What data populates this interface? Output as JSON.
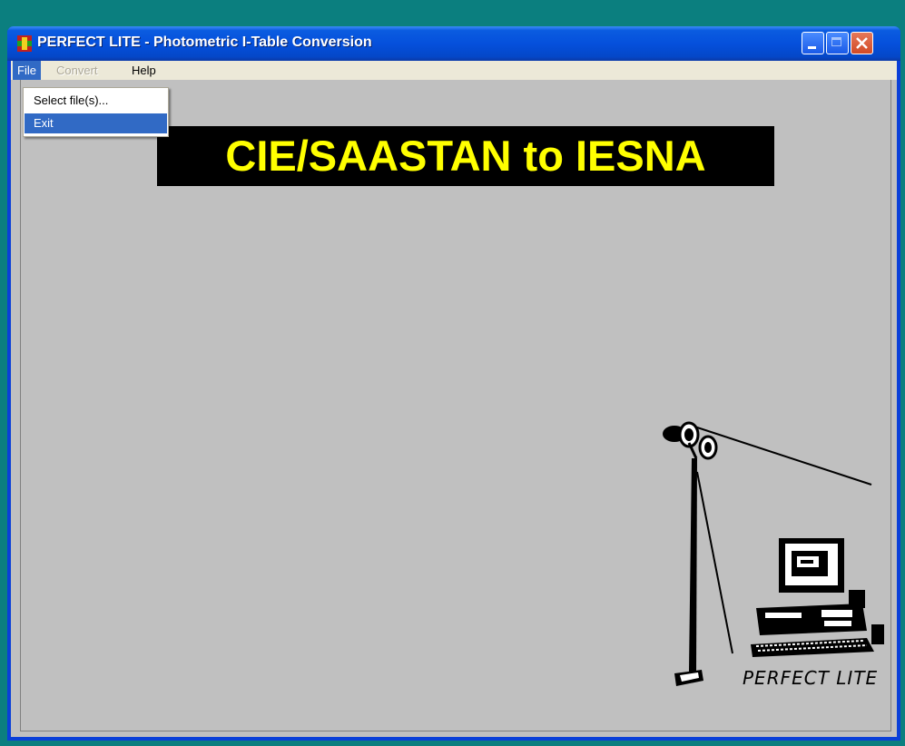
{
  "window": {
    "title": "PERFECT LITE - Photometric I-Table Conversion"
  },
  "menubar": {
    "file": "File",
    "convert": "Convert",
    "help": "Help"
  },
  "file_menu": {
    "items": [
      "Select file(s)...",
      "Exit"
    ],
    "highlighted": "Exit"
  },
  "banner": {
    "text": "CIE/SAASTAN to IESNA",
    "text_color": "#ffff00",
    "background": "#000000"
  },
  "logo": {
    "text": "PERFECT LITE"
  },
  "colors": {
    "desktop": "#0b7f7f",
    "client": "#c0c0c0",
    "highlight": "#316ac5"
  },
  "icons": [
    "app-icon",
    "minimize-icon",
    "maximize-icon",
    "close-icon",
    "light-pole-icon",
    "computer-icon"
  ]
}
